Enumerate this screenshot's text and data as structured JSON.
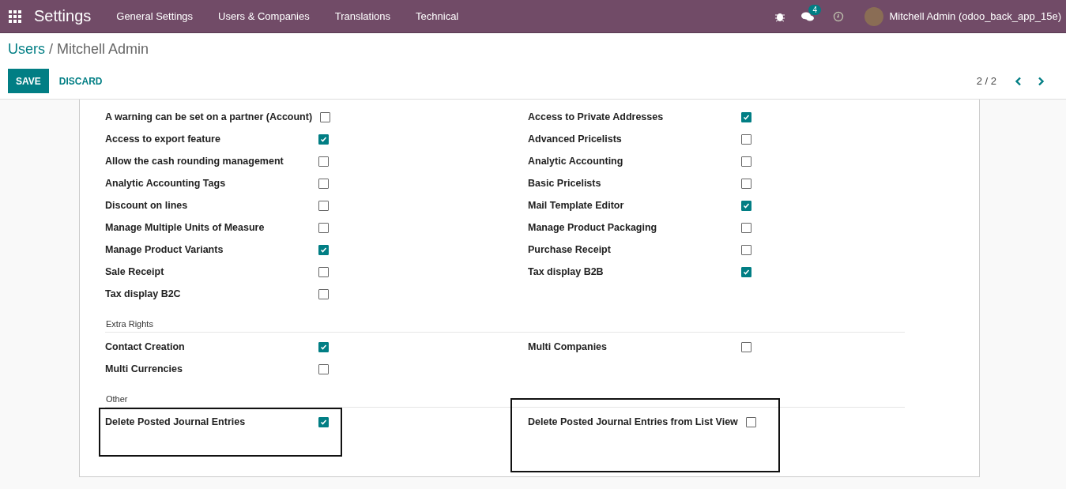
{
  "navbar": {
    "app_title": "Settings",
    "menu": [
      "General Settings",
      "Users & Companies",
      "Translations",
      "Technical"
    ],
    "messages_count": "4",
    "user": "Mitchell Admin (odoo_back_app_15e)"
  },
  "breadcrumb": {
    "parent": "Users",
    "separator": "/",
    "current": "Mitchell Admin"
  },
  "buttons": {
    "save": "SAVE",
    "discard": "DISCARD"
  },
  "pager": "2 / 2",
  "sections": [
    {
      "items": [
        {
          "label": "A warning can be set on a partner (Account)",
          "checked": false,
          "highlighted": false
        },
        {
          "label": "Access to Private Addresses",
          "checked": true,
          "highlighted": false
        },
        {
          "label": "Access to export feature",
          "checked": true,
          "highlighted": false
        },
        {
          "label": "Advanced Pricelists",
          "checked": false,
          "highlighted": false
        },
        {
          "label": "Allow the cash rounding management",
          "checked": false,
          "highlighted": false
        },
        {
          "label": "Analytic Accounting",
          "checked": false,
          "highlighted": false
        },
        {
          "label": "Analytic Accounting Tags",
          "checked": false,
          "highlighted": false
        },
        {
          "label": "Basic Pricelists",
          "checked": false,
          "highlighted": false
        },
        {
          "label": "Discount on lines",
          "checked": false,
          "highlighted": false
        },
        {
          "label": "Mail Template Editor",
          "checked": true,
          "highlighted": false
        },
        {
          "label": "Manage Multiple Units of Measure",
          "checked": false,
          "highlighted": false
        },
        {
          "label": "Manage Product Packaging",
          "checked": false,
          "highlighted": false
        },
        {
          "label": "Manage Product Variants",
          "checked": true,
          "highlighted": false
        },
        {
          "label": "Purchase Receipt",
          "checked": false,
          "highlighted": false
        },
        {
          "label": "Sale Receipt",
          "checked": false,
          "highlighted": false
        },
        {
          "label": "Tax display B2B",
          "checked": true,
          "highlighted": false
        },
        {
          "label": "Tax display B2C",
          "checked": false,
          "highlighted": false
        }
      ]
    },
    {
      "title": "Extra Rights",
      "items": [
        {
          "label": "Contact Creation",
          "checked": true,
          "highlighted": false
        },
        {
          "label": "Multi Companies",
          "checked": false,
          "highlighted": false
        },
        {
          "label": "Multi Currencies",
          "checked": false,
          "highlighted": false
        }
      ]
    },
    {
      "title": "Other",
      "items": [
        {
          "label": "Delete Posted Journal Entries",
          "checked": true,
          "highlighted": true
        },
        {
          "label": "Delete Posted Journal Entries from List View",
          "checked": false,
          "highlighted": true
        }
      ]
    }
  ]
}
